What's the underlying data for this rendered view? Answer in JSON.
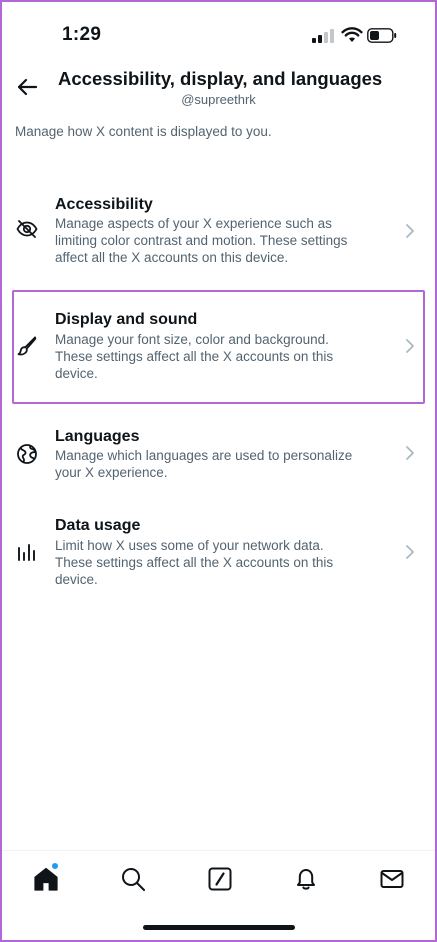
{
  "status_bar": {
    "time": "1:29"
  },
  "header": {
    "title": "Accessibility, display, and languages",
    "handle": "@supreethrk",
    "back_icon": "arrow-left-icon"
  },
  "description": "Manage how X content is displayed to you.",
  "settings": [
    {
      "title": "Accessibility",
      "icon": "eye-slash-icon",
      "lines": [
        "Manage aspects of your X experience such as",
        "limiting color contrast and motion. These settings",
        "affect all the X accounts on this device."
      ]
    },
    {
      "title": "Display and sound",
      "icon": "paintbrush-icon",
      "lines": [
        "Manage your font size, color and background.",
        "These settings affect all the X accounts on this",
        "device."
      ]
    },
    {
      "title": "Languages",
      "icon": "globe-icon",
      "lines": [
        "Manage which languages are used to personalize",
        "your X experience."
      ]
    },
    {
      "title": "Data usage",
      "icon": "bar-chart-icon",
      "lines": [
        "Limit how X uses some of your network data.",
        "These settings affect all the X accounts on this",
        "device."
      ]
    }
  ],
  "bottom_nav": [
    "home-icon",
    "search-icon",
    "compose-icon",
    "bell-icon",
    "mail-icon"
  ],
  "colors": {
    "highlight": "#b366d6",
    "text_primary": "#0f1419",
    "text_secondary": "#536471",
    "accent": "#1d9bf0"
  }
}
